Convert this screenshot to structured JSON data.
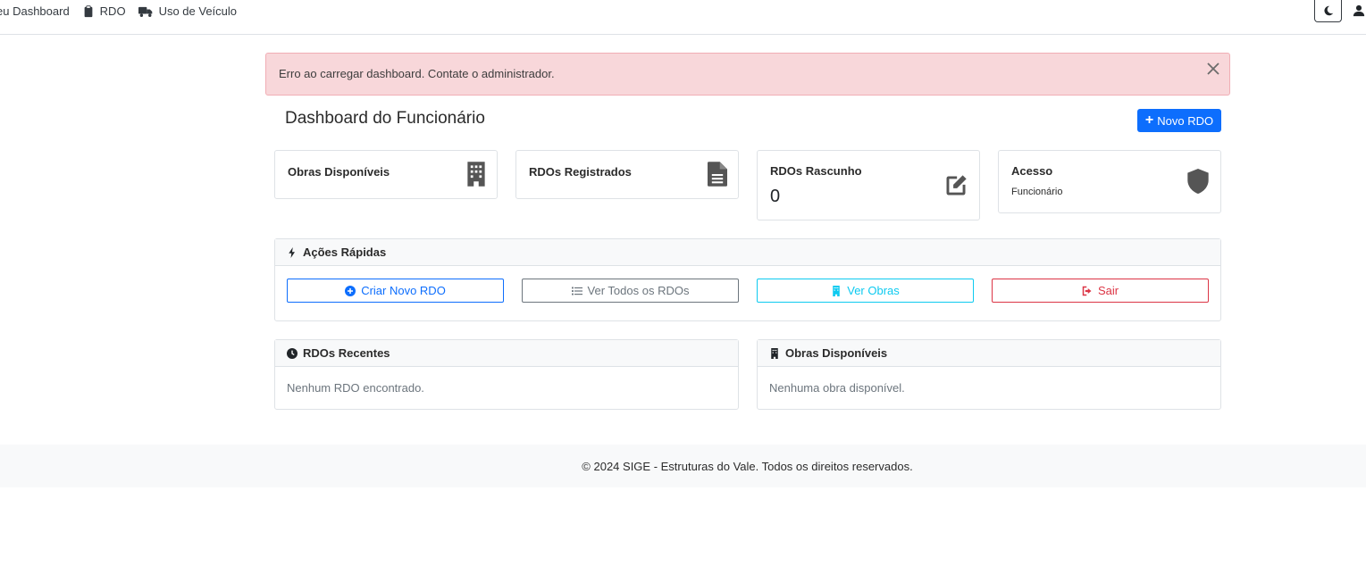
{
  "navbar": {
    "items": [
      {
        "label": "eu Dashboard",
        "icon": "dashboard-icon"
      },
      {
        "label": "RDO",
        "icon": "clipboard-icon"
      },
      {
        "label": "Uso de Veículo",
        "icon": "truck-icon"
      }
    ],
    "theme_toggle_icon": "moon-icon",
    "user_icon": "user-icon"
  },
  "alert": {
    "message": "Erro ao carregar dashboard. Contate o administrador.",
    "close_icon": "close-icon"
  },
  "header": {
    "title": "Dashboard do Funcionário",
    "new_button_label": "Novo RDO"
  },
  "stats": [
    {
      "label": "Obras Disponíveis",
      "value": "",
      "sub": "",
      "icon": "building-icon"
    },
    {
      "label": "RDOs Registrados",
      "value": "",
      "sub": "",
      "icon": "document-icon"
    },
    {
      "label": "RDOs Rascunho",
      "value": "0",
      "sub": "",
      "icon": "edit-icon"
    },
    {
      "label": "Acesso",
      "value": "",
      "sub": "Funcionário",
      "icon": "shield-icon"
    }
  ],
  "quick_actions": {
    "title": "Ações Rápidas",
    "buttons": [
      {
        "label": "Criar Novo RDO",
        "color": "#0d6efd",
        "icon": "plus-circle-icon"
      },
      {
        "label": "Ver Todos os RDOs",
        "color": "#6c757d",
        "icon": "list-icon"
      },
      {
        "label": "Ver Obras",
        "color": "#0dcaf0",
        "icon": "building-icon"
      },
      {
        "label": "Sair",
        "color": "#dc3545",
        "icon": "sign-out-icon"
      }
    ]
  },
  "recent_rdos": {
    "title": "RDOs Recentes",
    "empty_text": "Nenhum RDO encontrado."
  },
  "available_obras": {
    "title": "Obras Disponíveis",
    "empty_text": "Nenhuma obra disponível."
  },
  "footer": {
    "text": "© 2024 SIGE - Estruturas do Vale. Todos os direitos reservados."
  },
  "colors": {
    "primary": "#0d6efd",
    "alert_bg": "#f8d7da",
    "info": "#0dcaf0",
    "danger": "#dc3545",
    "secondary": "#6c757d"
  }
}
